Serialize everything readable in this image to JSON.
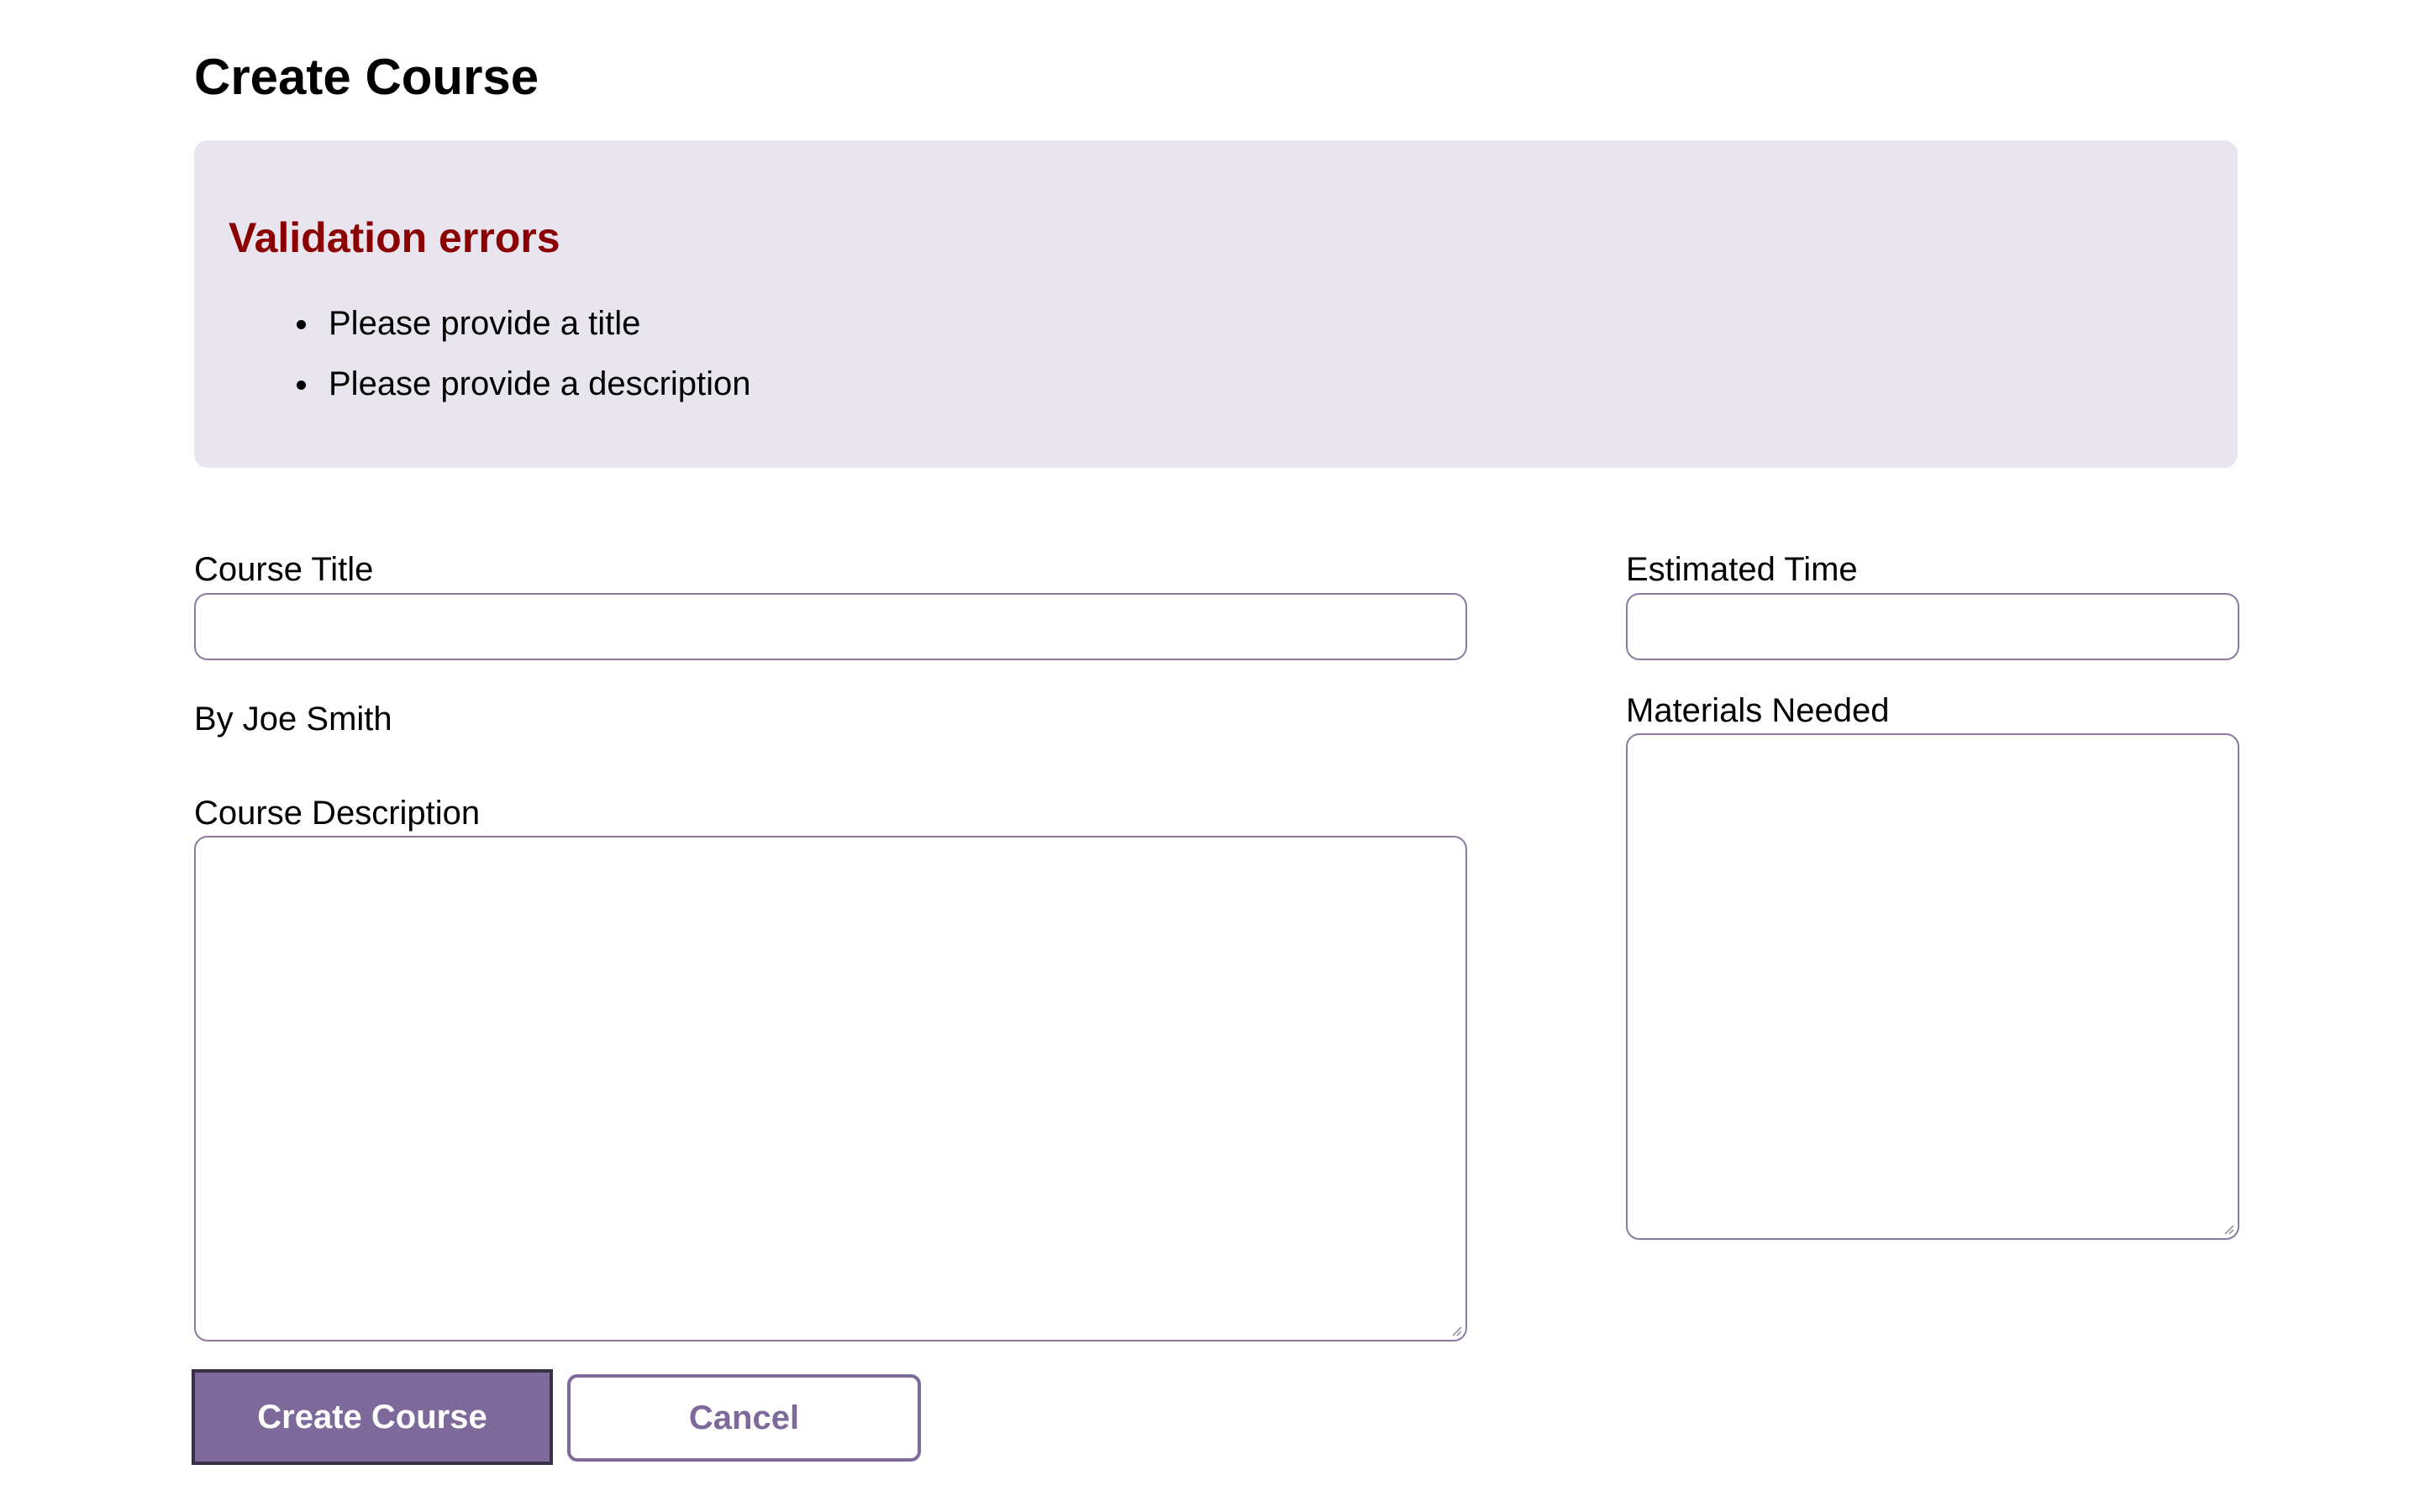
{
  "page": {
    "title": "Create Course"
  },
  "validation": {
    "heading": "Validation errors",
    "errors": [
      "Please provide a title",
      "Please provide a description"
    ]
  },
  "form": {
    "course_title_label": "Course Title",
    "course_title_value": "",
    "author_text": "By Joe Smith",
    "course_description_label": "Course Description",
    "course_description_value": "",
    "estimated_time_label": "Estimated Time",
    "estimated_time_value": "",
    "materials_needed_label": "Materials Needed",
    "materials_needed_value": ""
  },
  "buttons": {
    "submit_label": "Create Course",
    "cancel_label": "Cancel"
  },
  "colors": {
    "accent": "#7d6a9b",
    "error_heading": "#8b0000",
    "error_box_bg": "#e8e5ef",
    "field_border": "#8a7a9e"
  }
}
